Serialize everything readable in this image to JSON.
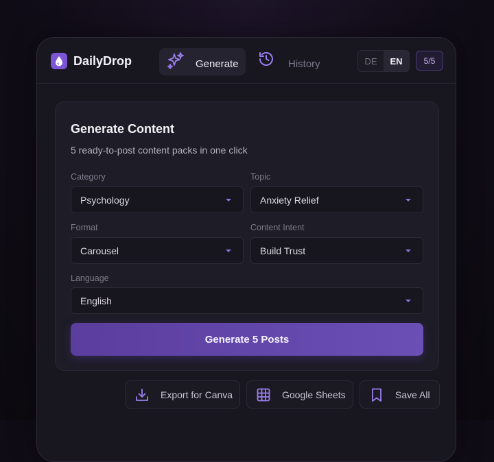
{
  "header": {
    "brand": "DailyDrop",
    "tabs": [
      {
        "label": "Generate",
        "icon": "sparkles-icon",
        "active": true
      },
      {
        "label": "History",
        "icon": "history-icon",
        "active": false
      }
    ],
    "languages": [
      "DE",
      "EN"
    ],
    "active_language": "EN",
    "counter": "5/5"
  },
  "card": {
    "title": "Generate Content",
    "subtitle": "5 ready-to-post content packs in one click",
    "fields": {
      "category": {
        "label": "Category",
        "value": "Psychology"
      },
      "topic": {
        "label": "Topic",
        "value": "Anxiety Relief"
      },
      "format": {
        "label": "Format",
        "value": "Carousel"
      },
      "intent": {
        "label": "Content Intent",
        "value": "Build Trust"
      },
      "language": {
        "label": "Language",
        "value": "English"
      }
    },
    "generate_button": "Generate 5 Posts"
  },
  "actions": [
    {
      "label": "Export for Canva",
      "icon": "download-icon"
    },
    {
      "label": "Google Sheets",
      "icon": "grid-table-icon"
    },
    {
      "label": "Save All",
      "icon": "bookmark-icon"
    }
  ],
  "colors": {
    "accent": "#7b55d6",
    "button": "#6046a8",
    "background": "#18161f"
  }
}
